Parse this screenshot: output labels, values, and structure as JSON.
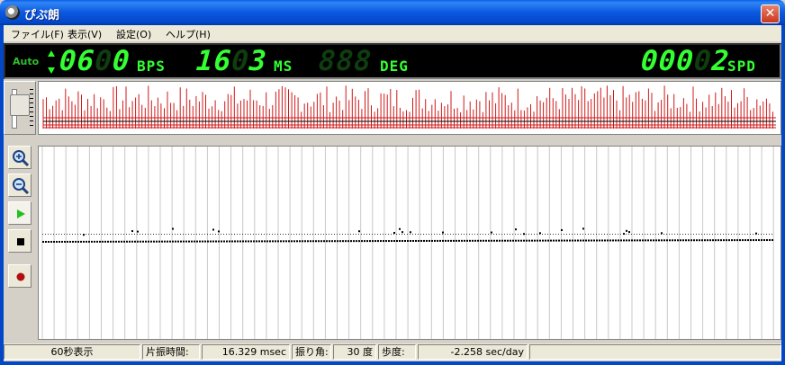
{
  "window": {
    "title": "ぴぷ朗",
    "close_glyph": "✕"
  },
  "menu": {
    "items": [
      {
        "label": "ファイル(F)"
      },
      {
        "label": "表示(V)"
      },
      {
        "label": "設定(O)"
      },
      {
        "label": "ヘルプ(H)"
      }
    ]
  },
  "display": {
    "auto_label": "Auto",
    "bph_lead": "06",
    "bph_ghost": "0",
    "bph_tail": "0",
    "bph_unit": "BPS",
    "ms_lead": "16",
    "ms_ghost": "0",
    "ms_tail": "3",
    "ms_unit": "MS",
    "deg_value": "888",
    "deg_unit": "DEG",
    "spd_lead": "000",
    "spd_ghost": "0",
    "spd_tail": "2",
    "spd_unit": "SPD",
    "digit_color": "#33ff33",
    "ghost_color": "#0f3d0f"
  },
  "spike_strip": {
    "bar_color": "#d01818",
    "bar_count": 230
  },
  "tools": [
    {
      "name": "zoom-in-icon"
    },
    {
      "name": "zoom-out-icon"
    },
    {
      "name": "play-icon"
    },
    {
      "name": "stop-icon"
    },
    {
      "name": "record-icon"
    }
  ],
  "status": {
    "view_mode": "60秒表示",
    "half_swing_label": "片振時間:",
    "half_swing_value": "16.329 msec",
    "amplitude_label": "振り角:",
    "amplitude_value": "30 度",
    "rate_label": "歩度:",
    "rate_value": "-2.258 sec/day"
  }
}
